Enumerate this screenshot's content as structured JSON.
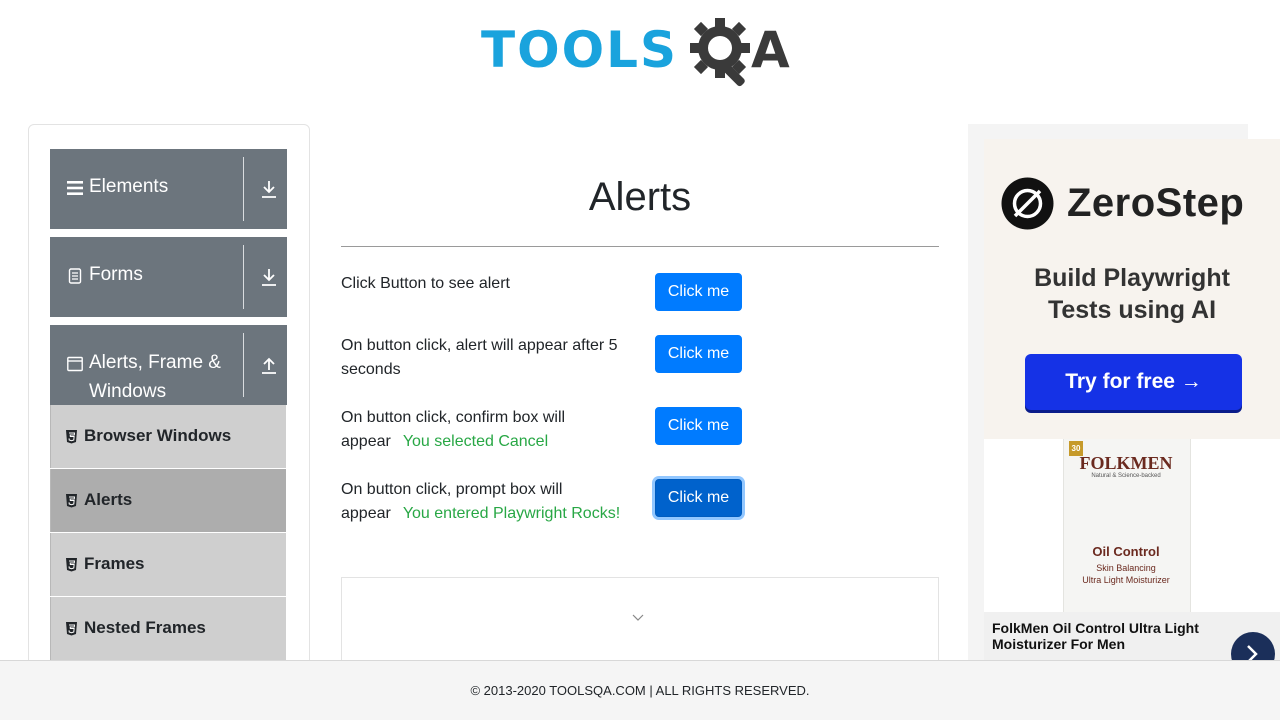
{
  "header": {
    "logo_text": "TOOLS",
    "logo_suffix": "A"
  },
  "sidebar": {
    "groups": [
      {
        "label": "Elements",
        "icon": "hamburger-icon",
        "arrow": "download-icon"
      },
      {
        "label": "Forms",
        "icon": "document-icon",
        "arrow": "download-icon"
      },
      {
        "label": "Alerts, Frame &",
        "label2": "Windows",
        "icon": "window-icon",
        "arrow": "upload-icon"
      }
    ],
    "items": [
      {
        "label": "Browser Windows",
        "active": false
      },
      {
        "label": "Alerts",
        "active": true
      },
      {
        "label": "Frames",
        "active": false
      },
      {
        "label": "Nested Frames",
        "active": false
      }
    ]
  },
  "main": {
    "title": "Alerts",
    "rows": [
      {
        "line1": "Click Button to see alert",
        "line2": "",
        "result": "",
        "button": "Click me"
      },
      {
        "line1": "On button click, alert will appear after 5",
        "line2": "seconds",
        "result": "",
        "button": "Click me"
      },
      {
        "line1": "On button click, confirm box will",
        "line2": "appear",
        "result": "You selected Cancel",
        "button": "Click me"
      },
      {
        "line1": "On button click, prompt box will",
        "line2": "appear",
        "result": "You entered Playwright Rocks!",
        "button": "Click me"
      }
    ]
  },
  "ad": {
    "brand": "ZeroStep",
    "tagline1": "Build Playwright",
    "tagline2": "Tests using AI",
    "cta": "Try for free →",
    "product_brand": "FOLKMEN",
    "product_brand_sub": "Natural & Science-backed",
    "product_badge": "30",
    "product_name": "Oil Control",
    "product_sub1": "Skin Balancing",
    "product_sub2": "Ultra Light Moisturizer",
    "caption": "FolkMen Oil Control Ultra Light Moisturizer For Men"
  },
  "footer": {
    "text": "© 2013-2020 TOOLSQA.COM | ALL RIGHTS RESERVED."
  },
  "colors": {
    "logo_blue": "#1aa3dd",
    "logo_dark": "#3a3a3a",
    "sidebar_group": "#6c757d",
    "sidebar_item": "#cfcfcf",
    "sidebar_item_active": "#adadad",
    "button": "#007bff",
    "result_green": "#28a745",
    "ad_cta": "#1532e6"
  }
}
